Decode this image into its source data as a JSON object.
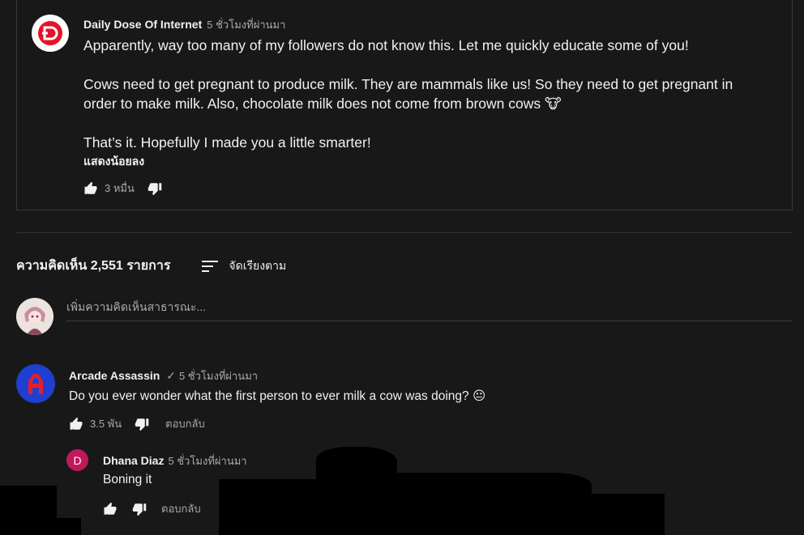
{
  "post": {
    "author": "Daily Dose Of Internet",
    "time": "5 ชั่วโมงที่ผ่านมา",
    "lines": [
      "Apparently, way too many of my followers do not know this. Let me quickly educate some of you!",
      "",
      "Cows need to get pregnant to produce milk. They are mammals like us! So they need to get pregnant in order to make milk. Also, chocolate milk does not come from brown cows 🐮",
      "",
      "That’s it. Hopefully I made you a little smarter!"
    ],
    "show_less": "แสดงน้อยลง",
    "like_count": "3 หมื่น"
  },
  "comments_section": {
    "count_label": "ความคิดเห็น 2,551 รายการ",
    "sort_label": "จัดเรียงตาม",
    "placeholder": "เพิ่มความคิดเห็นสาธารณะ..."
  },
  "comments": [
    {
      "author": "Arcade Assassin",
      "verified": "✓",
      "time": "5 ชั่วโมงที่ผ่านมา",
      "text": "Do you ever wonder what the first person to ever milk a cow was doing? 😐",
      "like_count": "3.5 พัน",
      "reply_label": "ตอบกลับ",
      "avatar_letter": "A",
      "avatar_color": "#1f3fd0"
    },
    {
      "author": "Dhana Diaz",
      "time": "5 ชั่วโมงที่ผ่านมา",
      "text": "Boning it",
      "reply_label": "ตอบกลับ",
      "avatar_letter": "D",
      "avatar_color": "#c2185b"
    }
  ],
  "colors": {
    "background": "#181818",
    "text": "#f1f1f1",
    "muted": "#aaaaaa",
    "brand_red": "#e4132a"
  }
}
